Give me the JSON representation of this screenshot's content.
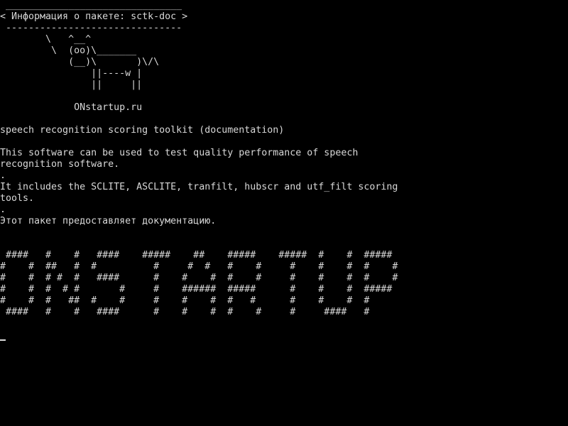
{
  "terminal": {
    "lines": [
      " _______________________________",
      "< Информация о пакете: sctk-doc >",
      " -------------------------------",
      "        \\   ^__^",
      "         \\  (oo)\\_______",
      "            (__)\\       )\\/\\",
      "                ||----w |",
      "                ||     ||",
      "",
      "             ONstartup.ru",
      "",
      "speech recognition scoring toolkit (documentation)",
      "",
      "This software can be used to test quality performance of speech",
      "recognition software.",
      ".",
      "It includes the SCLITE, ASCLITE, tranfilt, hubscr and utf_filt scoring",
      "tools.",
      ".",
      "Этот пакет предоставляет документацию.",
      "",
      "",
      " ####   #    #   ####    #####    ##    #####    #####  #    #  #####",
      "#    #  ##   #  #          #     #  #   #    #     #    #    #  #    #",
      "#    #  # #  #   ####      #    #    #  #    #     #    #    #  #    #",
      "#    #  #  # #       #     #    ######  #####      #    #    #  #####",
      "#    #  #   ##  #    #     #    #    #  #   #      #    #    #  #",
      " ####   #    #   ####      #    #    #  #    #     #     ####   #"
    ]
  }
}
